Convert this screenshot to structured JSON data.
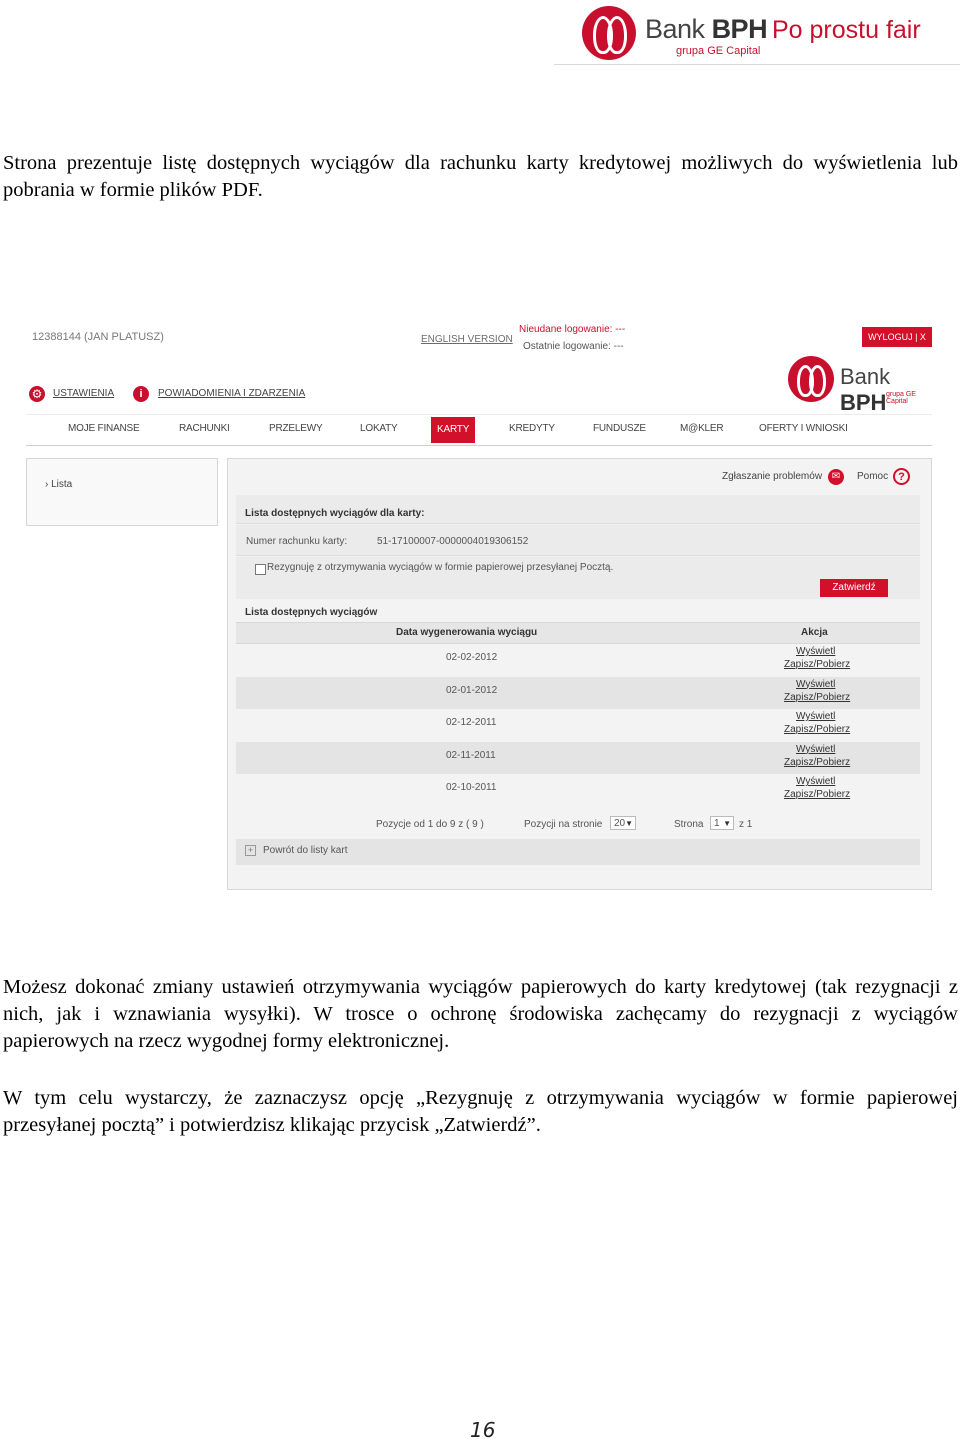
{
  "header": {
    "bank_name": "Bank",
    "bank_name_bold": "BPH",
    "group": "grupa GE Capital",
    "slogan": "Po prostu fair"
  },
  "intro": "Strona prezentuje listę dostępnych wyciągów dla rachunku karty kredytowej możliwych do wyświetlenia lub pobrania w formie plików PDF.",
  "screenshot": {
    "user": "12388144  (JAN PLATUSZ)",
    "english_version": "ENGLISH VERSION",
    "failed_login": "Nieudane logowanie: ---",
    "last_login": "Ostatnie logowanie: ---",
    "logout": "WYLOGUJ | X",
    "settings": "USTAWIENIA",
    "notifications": "POWIADOMIENIA I ZDARZENIA",
    "logo_bank": "Bank",
    "logo_bank_bold": "BPH",
    "logo_group": "grupa GE Capital",
    "nav": [
      "MOJE FINANSE",
      "RACHUNKI",
      "PRZELEWY",
      "LOKATY",
      "KARTY",
      "KREDYTY",
      "FUNDUSZE",
      "M@KLER",
      "OFERTY I WNIOSKI"
    ],
    "side_item": "› Lista",
    "report_problem": "Zgłaszanie problemów",
    "help": "Pomoc",
    "list_for_card": "Lista dostępnych wyciągów dla karty:",
    "account_label": "Numer rachunku karty:",
    "account_number": "51-17100007-0000004019306152",
    "resign_label": "Rezygnuję z otrzymywania wyciągów w formie papierowej przesyłanej Pocztą.",
    "confirm": "Zatwierdź",
    "list_title": "Lista dostępnych wyciągów",
    "col_date": "Data wygenerowania wyciągu",
    "col_action": "Akcja",
    "rows": [
      {
        "date": "02-02-2012",
        "view": "Wyświetl",
        "save": "Zapisz/Pobierz"
      },
      {
        "date": "02-01-2012",
        "view": "Wyświetl",
        "save": "Zapisz/Pobierz"
      },
      {
        "date": "02-12-2011",
        "view": "Wyświetl",
        "save": "Zapisz/Pobierz"
      },
      {
        "date": "02-11-2011",
        "view": "Wyświetl",
        "save": "Zapisz/Pobierz"
      },
      {
        "date": "02-10-2011",
        "view": "Wyświetl",
        "save": "Zapisz/Pobierz"
      }
    ],
    "positions": "Pozycje od 1 do 9 z ( 9 )",
    "per_page_label": "Pozycji na stronie",
    "per_page_value": "20",
    "page_label": "Strona",
    "page_value": "1",
    "page_of": "z 1",
    "back": "Powrót do listy kart"
  },
  "para2": "Możesz dokonać zmiany ustawień otrzymywania wyciągów papierowych do karty kredytowej (tak rezygnacji z nich, jak i wznawiania wysyłki). W trosce o ochronę środowiska zachęcamy do rezygnacji z wyciągów papierowych na rzecz wygodnej formy elektronicznej.",
  "para3": "W tym celu wystarczy, że zaznaczysz opcję „Rezygnuję z otrzymywania wyciągów w formie papierowej przesyłanej pocztą” i potwierdzisz klikając przycisk „Zatwierdź”.",
  "page_number": "16"
}
